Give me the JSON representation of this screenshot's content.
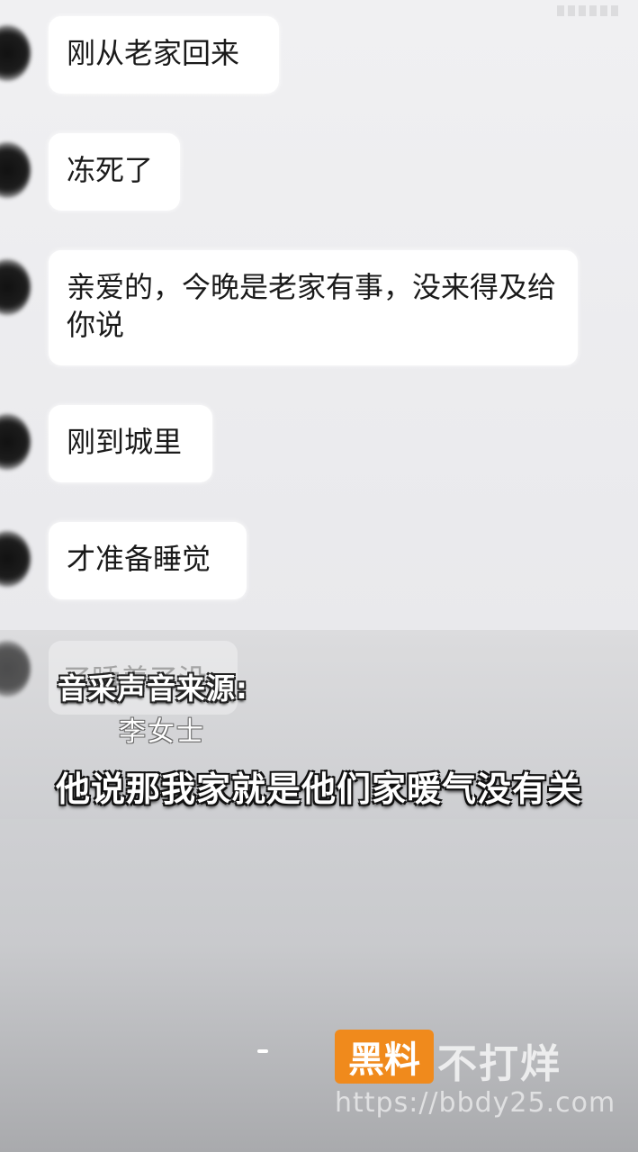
{
  "messages": [
    {
      "text": "刚从老家回来"
    },
    {
      "text": "冻死了"
    },
    {
      "text": "亲爱的，今晚是老家有事，没来得及给你说"
    },
    {
      "text": "刚到城里"
    },
    {
      "text": "才准备睡觉"
    }
  ],
  "partial_message": "了睡着了没",
  "overlay": {
    "source_label": "音采声音来源:",
    "source_name": "李女士",
    "subtitle": "他说那我家就是他们家暖气没有关"
  },
  "watermark": {
    "brand_box": "黑料",
    "brand_text": "不打烊",
    "url": "https://bbdy25.com"
  }
}
